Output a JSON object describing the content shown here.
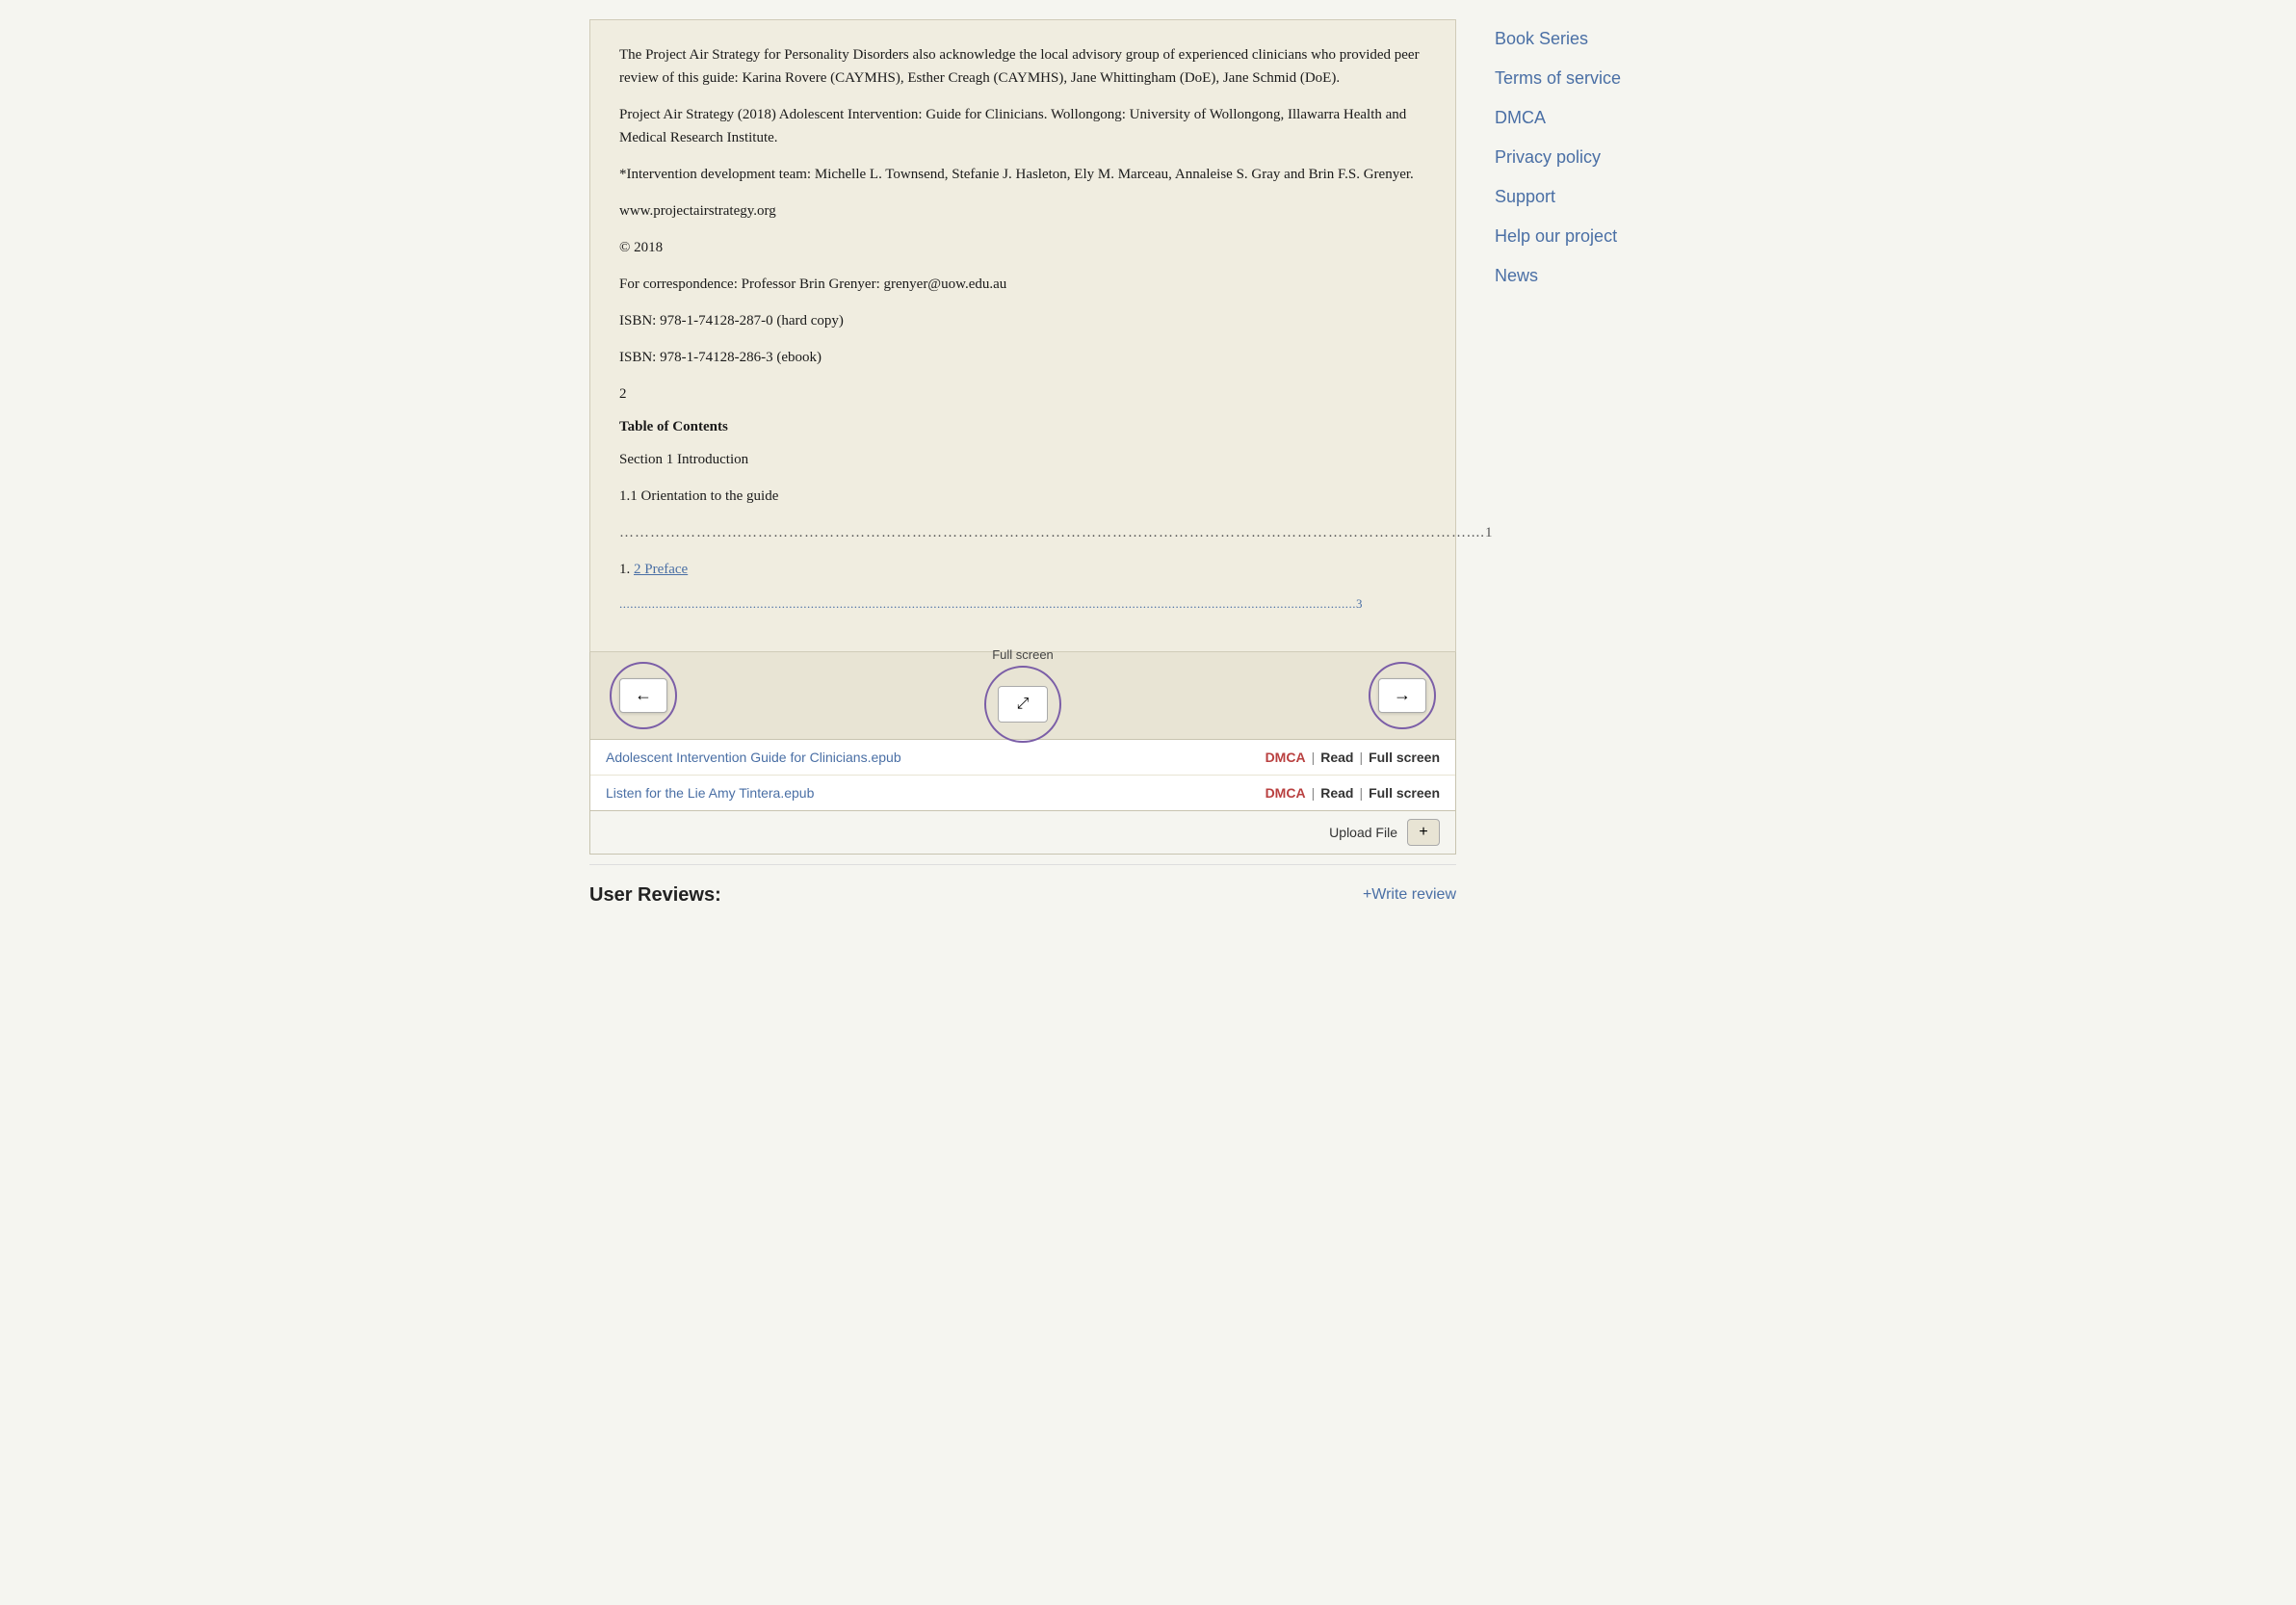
{
  "sidebar": {
    "links": [
      {
        "id": "book-series",
        "label": "Book Series"
      },
      {
        "id": "terms-of-service",
        "label": "Terms of service"
      },
      {
        "id": "dmca",
        "label": "DMCA"
      },
      {
        "id": "privacy-policy",
        "label": "Privacy policy"
      },
      {
        "id": "support",
        "label": "Support"
      },
      {
        "id": "help-our-project",
        "label": "Help our project"
      },
      {
        "id": "news",
        "label": "News"
      }
    ]
  },
  "book": {
    "paragraphs": [
      "The Project Air Strategy for Personality Disorders also acknowledge the local advisory group of experienced clinicians who provided peer review of this guide: Karina Rovere (CAYMHS), Esther Creagh (CAYMHS), Jane Whittingham (DoE), Jane Schmid (DoE).",
      "Project Air Strategy (2018) Adolescent Intervention: Guide for Clinicians. Wollongong: University of Wollongong, Illawarra Health and Medical Research Institute.",
      "*Intervention development team: Michelle L. Townsend, Stefanie J. Hasleton, Ely M. Marceau, Annaleise S. Gray and Brin F.S. Grenyer.",
      "www.projectairstrategy.org",
      "© 2018",
      "For correspondence: Professor Brin Grenyer: grenyer@uow.edu.au",
      "ISBN: 978-1-74128-287-0 (hard copy)",
      "ISBN: 978-1-74128-286-3 (ebook)"
    ],
    "page_num": "2",
    "toc_title": "Table of Contents",
    "toc_entries": [
      {
        "text": "Section 1 Introduction",
        "link": null,
        "dotted_line": "",
        "page_ref": ""
      },
      {
        "text": "1.1 Orientation to the guide",
        "link": null,
        "dotted_line": "…………………………………………………………………………………………………………………………………………………....",
        "page_ref": "1"
      },
      {
        "text": "1. ",
        "link_text": "2 Preface",
        "link_href": "#preface",
        "dotted_line": "............................................................................................................................................................................................................",
        "page_ref": "3"
      }
    ]
  },
  "controls": {
    "prev_label": "←",
    "next_label": "→",
    "fullscreen_label": "Full screen",
    "fullscreen_icon": "⤢"
  },
  "files": [
    {
      "name": "Adolescent Intervention Guide for Clinicians.epub",
      "actions": [
        "DMCA",
        "Read",
        "Full screen"
      ]
    },
    {
      "name": "Listen for the Lie Amy Tintera.epub",
      "actions": [
        "DMCA",
        "Read",
        "Full screen"
      ]
    }
  ],
  "upload": {
    "label": "Upload File",
    "btn_icon": "+"
  },
  "user_reviews": {
    "title": "User Reviews:",
    "write_review": "+Write review"
  }
}
